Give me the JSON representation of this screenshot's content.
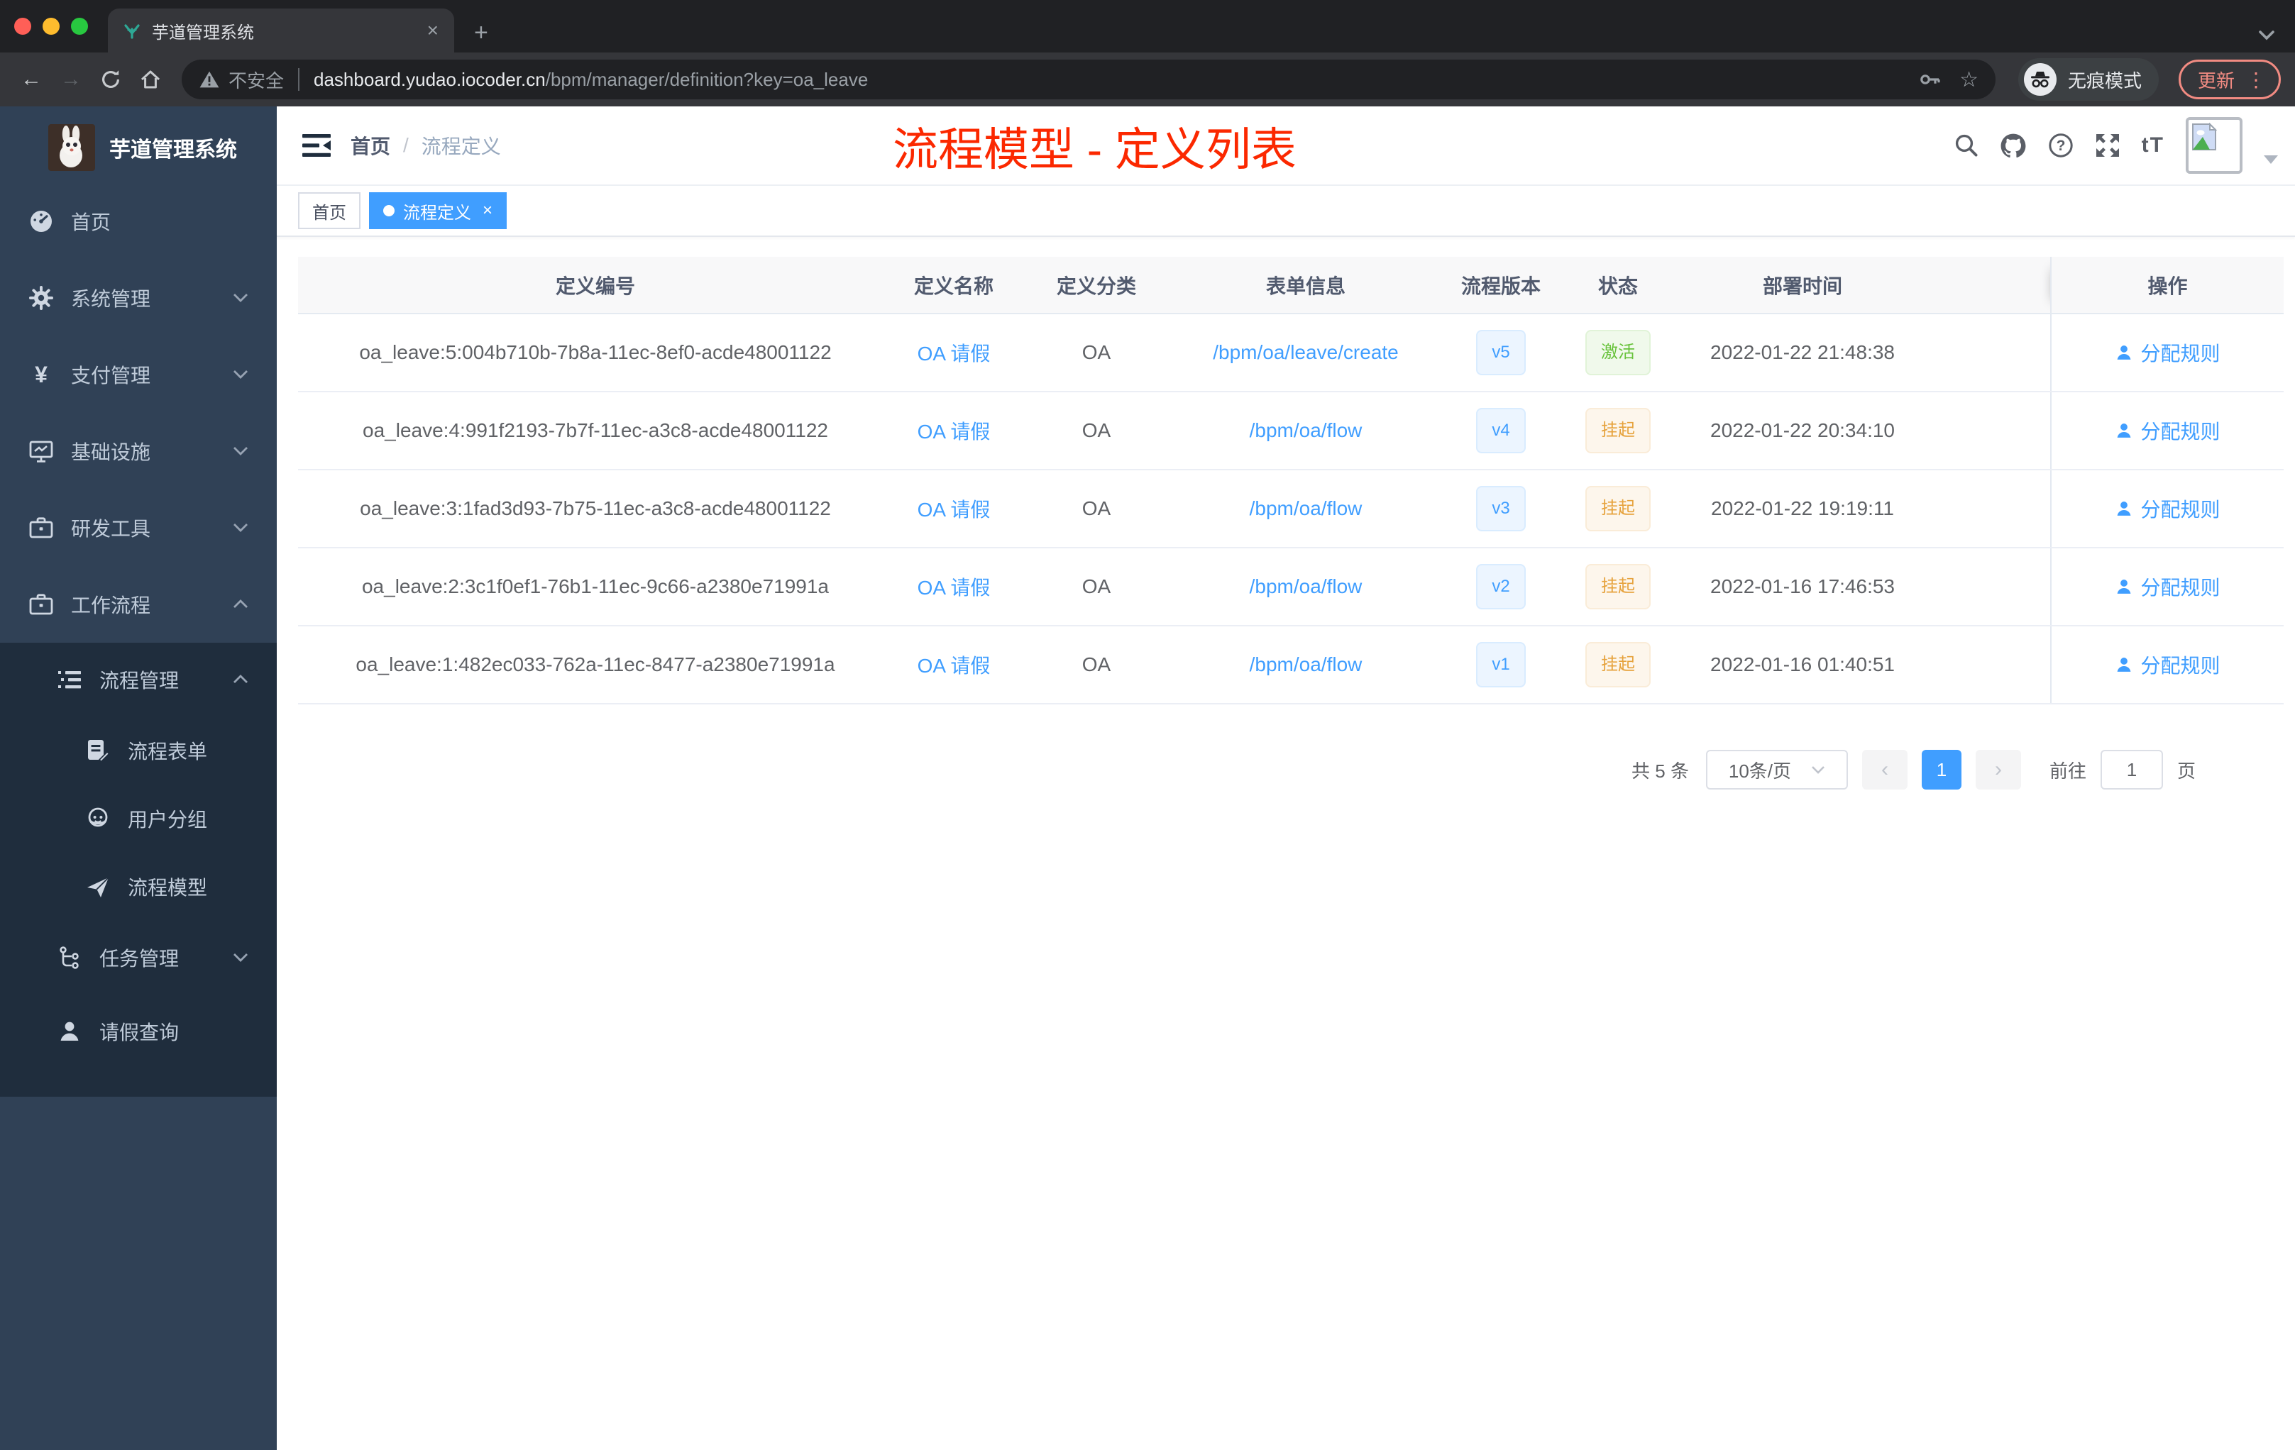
{
  "colors": {
    "accent": "#409eff",
    "success": "#67c23a",
    "warning": "#e6a23c",
    "annotation_red": "#fb2800"
  },
  "browser": {
    "tab_title": "芋道管理系统",
    "security_label": "不安全",
    "url_host": "dashboard.yudao.iocoder.cn",
    "url_path": "/bpm/manager/definition?key=oa_leave",
    "incognito_label": "无痕模式",
    "update_label": "更新"
  },
  "icons": {
    "close": "×",
    "new_tab": "+",
    "back": "←",
    "forward": "→",
    "star": "☆",
    "more_vertical": "⋮",
    "breadcrumb_separator": "/",
    "prev": "‹",
    "next": "›",
    "font_size": "tT",
    "tag_close": "×"
  },
  "sidebar": {
    "logo_title": "芋道管理系统",
    "items": [
      {
        "label": "首页"
      },
      {
        "label": "系统管理"
      },
      {
        "label": "支付管理"
      },
      {
        "label": "基础设施"
      },
      {
        "label": "研发工具"
      },
      {
        "label": "工作流程"
      },
      {
        "label": "流程管理"
      },
      {
        "label": "流程表单"
      },
      {
        "label": "用户分组"
      },
      {
        "label": "流程模型"
      },
      {
        "label": "任务管理"
      },
      {
        "label": "请假查询"
      }
    ]
  },
  "navbar": {
    "breadcrumb_home": "首页",
    "breadcrumb_current": "流程定义"
  },
  "annotation": "流程模型 - 定义列表",
  "tags": {
    "home": "首页",
    "current": "流程定义"
  },
  "table": {
    "columns": [
      "定义编号",
      "定义名称",
      "定义分类",
      "表单信息",
      "流程版本",
      "状态",
      "部署时间",
      "操作"
    ],
    "action_label": "分配规则",
    "rows": [
      {
        "id": "oa_leave:5:004b710b-7b8a-11ec-8ef0-acde48001122",
        "name": "OA 请假",
        "category": "OA",
        "form": "/bpm/oa/leave/create",
        "version": "v5",
        "status": "激活",
        "deploy_time": "2022-01-22 21:48:38",
        "action": "分配规则"
      },
      {
        "id": "oa_leave:4:991f2193-7b7f-11ec-a3c8-acde48001122",
        "name": "OA 请假",
        "category": "OA",
        "form": "/bpm/oa/flow",
        "version": "v4",
        "status": "挂起",
        "deploy_time": "2022-01-22 20:34:10",
        "action": "分配规则"
      },
      {
        "id": "oa_leave:3:1fad3d93-7b75-11ec-a3c8-acde48001122",
        "name": "OA 请假",
        "category": "OA",
        "form": "/bpm/oa/flow",
        "version": "v3",
        "status": "挂起",
        "deploy_time": "2022-01-22 19:19:11",
        "action": "分配规则"
      },
      {
        "id": "oa_leave:2:3c1f0ef1-76b1-11ec-9c66-a2380e71991a",
        "name": "OA 请假",
        "category": "OA",
        "form": "/bpm/oa/flow",
        "version": "v2",
        "status": "挂起",
        "deploy_time": "2022-01-16 17:46:53",
        "action": "分配规则"
      },
      {
        "id": "oa_leave:1:482ec033-762a-11ec-8477-a2380e71991a",
        "name": "OA 请假",
        "category": "OA",
        "form": "/bpm/oa/flow",
        "version": "v1",
        "status": "挂起",
        "deploy_time": "2022-01-16 01:40:51",
        "action": "分配规则"
      }
    ]
  },
  "pagination": {
    "total": "共 5 条",
    "page_size": "10条/页",
    "current_page": "1",
    "goto_label": "前往",
    "goto_value": "1",
    "page_unit": "页"
  }
}
